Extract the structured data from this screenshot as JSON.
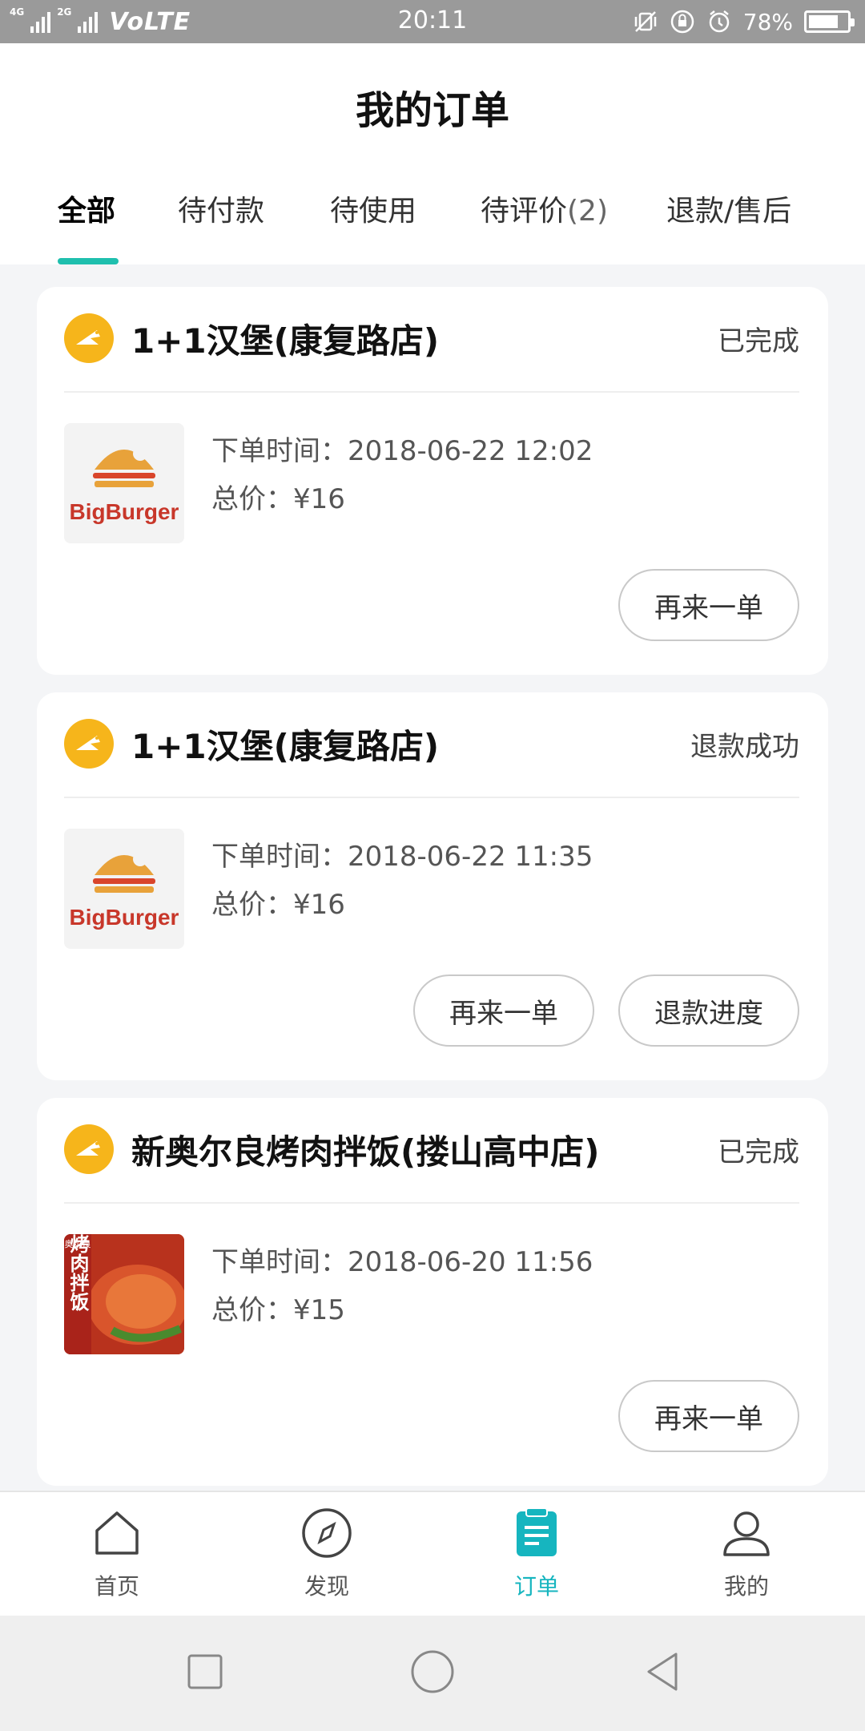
{
  "status_bar": {
    "network_tag": "4G",
    "network_tag2": "2G",
    "volte": "VoLTE",
    "time": "20:11",
    "battery": "78%",
    "battery_level": 0.78
  },
  "page": {
    "title": "我的订单"
  },
  "tabs": [
    {
      "label": "全部",
      "count": ""
    },
    {
      "label": "待付款",
      "count": ""
    },
    {
      "label": "待使用",
      "count": ""
    },
    {
      "label": "待评价",
      "count": "(2)"
    },
    {
      "label": "退款/售后",
      "count": ""
    }
  ],
  "orders": [
    {
      "shop": "1+1汉堡(康复路店)",
      "status": "已完成",
      "order_time": "下单时间：2018-06-22 12:02",
      "total": "总价：¥16",
      "thumb_brand": "BigBurger",
      "buttons": [
        "再来一单"
      ]
    },
    {
      "shop": "1+1汉堡(康复路店)",
      "status": "退款成功",
      "order_time": "下单时间：2018-06-22 11:35",
      "total": "总价：¥16",
      "thumb_brand": "BigBurger",
      "buttons": [
        "再来一单",
        "退款进度"
      ]
    },
    {
      "shop": "新奥尔良烤肉拌饭(搂山高中店)",
      "status": "已完成",
      "order_time": "下单时间：2018-06-20 11:56",
      "total": "总价：¥15",
      "thumb_text": "烤肉拌饭",
      "thumb_tag": "奥尔良",
      "buttons": [
        "再来一单"
      ]
    }
  ],
  "bottom_nav": [
    {
      "label": "首页",
      "icon": "home-icon"
    },
    {
      "label": "发现",
      "icon": "compass-icon"
    },
    {
      "label": "订单",
      "icon": "order-icon",
      "active": true
    },
    {
      "label": "我的",
      "icon": "user-icon"
    }
  ],
  "colors": {
    "accent": "#1fbfae",
    "nav_active": "#16b5bf",
    "shop_logo": "#f6b51b",
    "background": "#f4f5f7"
  }
}
